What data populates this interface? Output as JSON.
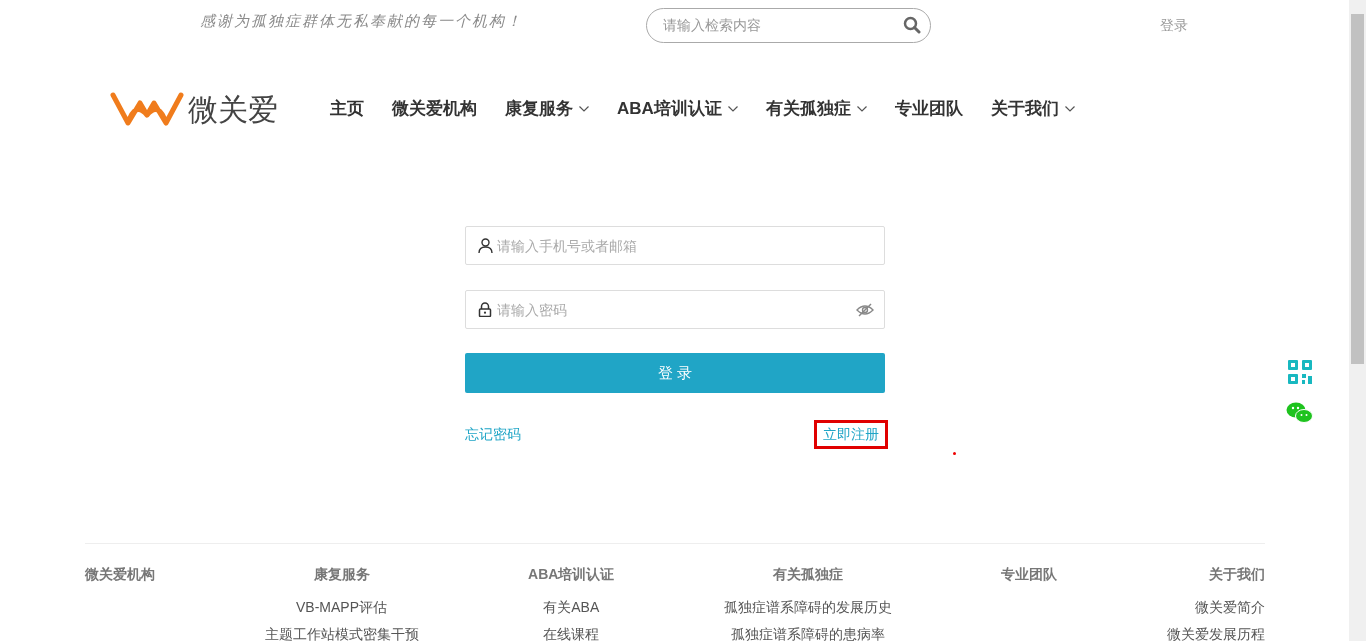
{
  "top_bar": {
    "slogan": "感谢为孤独症群体无私奉献的每一个机构！",
    "search": {
      "placeholder": "请输入检索内容"
    },
    "login_link": "登录"
  },
  "header": {
    "logo_text": "微关爱",
    "nav": [
      {
        "label": "主页",
        "dropdown": false
      },
      {
        "label": "微关爱机构",
        "dropdown": false
      },
      {
        "label": "康复服务",
        "dropdown": true
      },
      {
        "label": "ABA培训认证",
        "dropdown": true
      },
      {
        "label": "有关孤独症",
        "dropdown": true
      },
      {
        "label": "专业团队",
        "dropdown": false
      },
      {
        "label": "关于我们",
        "dropdown": true
      }
    ]
  },
  "login_form": {
    "account": {
      "placeholder": "请输入手机号或者邮箱"
    },
    "password": {
      "placeholder": "请输入密码"
    },
    "submit": "登 录",
    "forgot": "忘记密码",
    "register": {
      "label": "立即注册",
      "highlighted": true
    }
  },
  "footer": {
    "columns": [
      {
        "heading": "微关爱机构"
      },
      {
        "heading": "康复服务",
        "links": [
          "VB-MAPP评估",
          "主题工作站模式密集干预"
        ]
      },
      {
        "heading": "ABA培训认证",
        "links": [
          "有关ABA",
          "在线课程"
        ]
      },
      {
        "heading": "有关孤独症",
        "links": [
          "孤独症谱系障碍的发展历史",
          "孤独症谱系障碍的患病率"
        ]
      },
      {
        "heading": "专业团队"
      },
      {
        "heading": "关于我们",
        "links": [
          "微关爱简介",
          "微关爱发展历程"
        ]
      }
    ]
  }
}
